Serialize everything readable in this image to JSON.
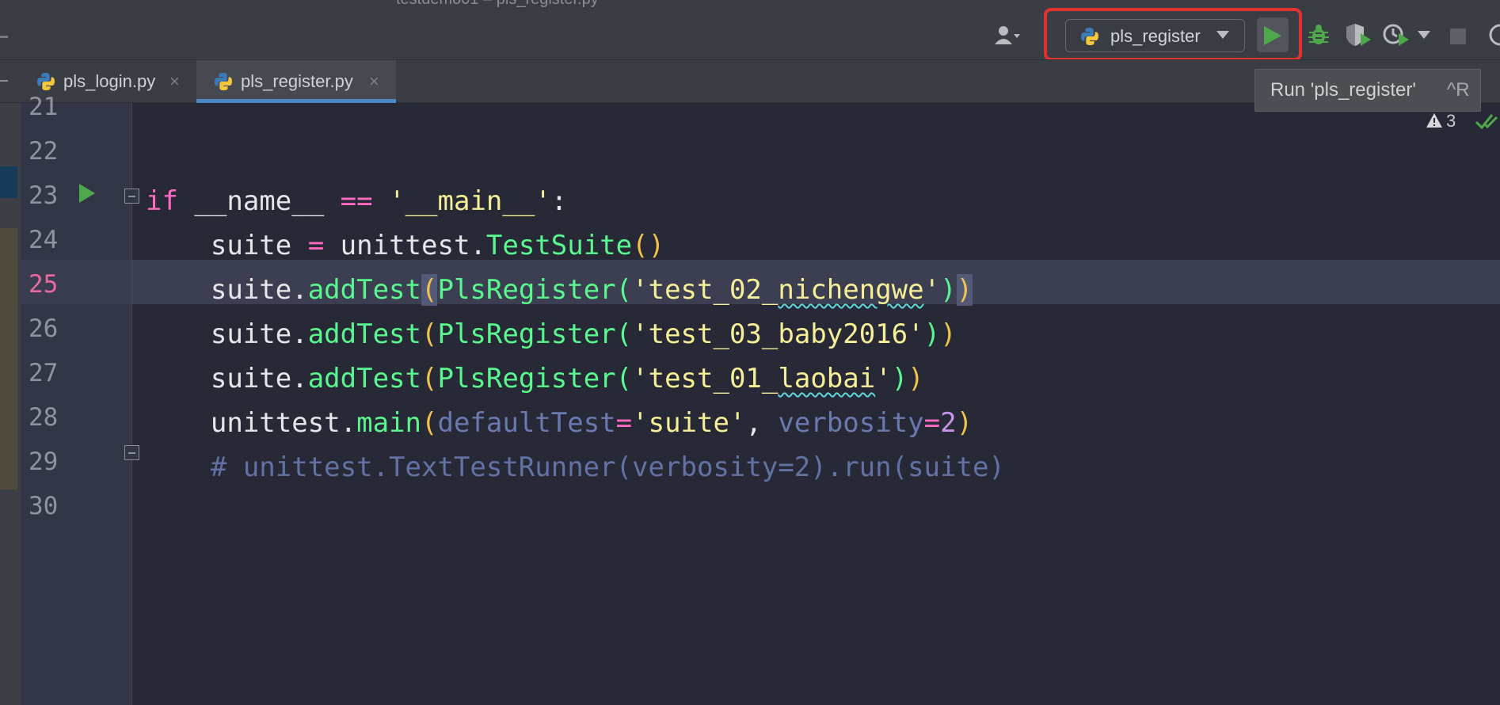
{
  "window": {
    "title": "testdemo01 – pls_register.py"
  },
  "toolbar": {
    "run_config_label": "pls_register",
    "run_button": "run-icon",
    "accent_highlight": "#e0322e"
  },
  "tabs": [
    {
      "label": "pls_login.py",
      "close": "×",
      "active": false
    },
    {
      "label": "pls_register.py",
      "close": "×",
      "active": true
    }
  ],
  "tooltip": {
    "text": "Run 'pls_register'",
    "shortcut": "^R"
  },
  "inspections": {
    "warnings": "3"
  },
  "editor": {
    "line_numbers": [
      "21",
      "22",
      "23",
      "24",
      "25",
      "26",
      "27",
      "28",
      "29",
      "30"
    ],
    "current_line": "25",
    "lines": [
      "",
      "",
      "if __name__ == '__main__':",
      "    suite = unittest.TestSuite()",
      "    suite.addTest(PlsRegister('test_02_nichengwe'))",
      "    suite.addTest(PlsRegister('test_03_baby2016'))",
      "    suite.addTest(PlsRegister('test_01_laobai'))",
      "    unittest.main(defaultTest='suite', verbosity=2)",
      "    # unittest.TextTestRunner(verbosity=2).run(suite)",
      ""
    ]
  }
}
